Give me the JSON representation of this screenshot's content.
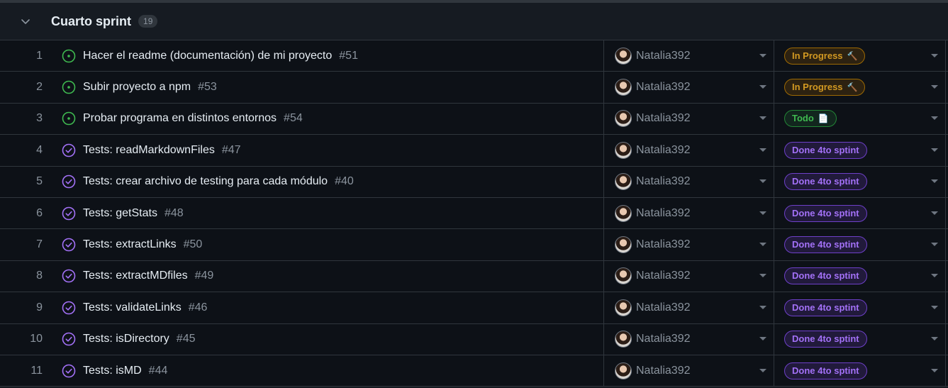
{
  "group": {
    "title": "Cuarto sprint",
    "count": "19"
  },
  "colors": {
    "open": "#3fb950",
    "done": "#a371f7",
    "progress": "#d29922"
  },
  "rows": [
    {
      "num": "1",
      "title": "Hacer el readme (documentación) de mi proyecto",
      "issue": "#51",
      "assignee": "Natalia392",
      "status": "In Progress",
      "status_emoji": "🔨",
      "state": "open",
      "kind": "progress"
    },
    {
      "num": "2",
      "title": "Subir proyecto a npm",
      "issue": "#53",
      "assignee": "Natalia392",
      "status": "In Progress",
      "status_emoji": "🔨",
      "state": "open",
      "kind": "progress"
    },
    {
      "num": "3",
      "title": "Probar programa en distintos entornos",
      "issue": "#54",
      "assignee": "Natalia392",
      "status": "Todo",
      "status_emoji": "📄",
      "state": "open",
      "kind": "todo"
    },
    {
      "num": "4",
      "title": "Tests: readMarkdownFiles",
      "issue": "#47",
      "assignee": "Natalia392",
      "status": "Done 4to sptint",
      "status_emoji": "",
      "state": "done",
      "kind": "done"
    },
    {
      "num": "5",
      "title": "Tests: crear archivo de testing para cada módulo",
      "issue": "#40",
      "assignee": "Natalia392",
      "status": "Done 4to sptint",
      "status_emoji": "",
      "state": "done",
      "kind": "done"
    },
    {
      "num": "6",
      "title": "Tests: getStats",
      "issue": "#48",
      "assignee": "Natalia392",
      "status": "Done 4to sptint",
      "status_emoji": "",
      "state": "done",
      "kind": "done"
    },
    {
      "num": "7",
      "title": "Tests: extractLinks",
      "issue": "#50",
      "assignee": "Natalia392",
      "status": "Done 4to sptint",
      "status_emoji": "",
      "state": "done",
      "kind": "done"
    },
    {
      "num": "8",
      "title": "Tests: extractMDfiles",
      "issue": "#49",
      "assignee": "Natalia392",
      "status": "Done 4to sptint",
      "status_emoji": "",
      "state": "done",
      "kind": "done"
    },
    {
      "num": "9",
      "title": "Tests: validateLinks",
      "issue": "#46",
      "assignee": "Natalia392",
      "status": "Done 4to sptint",
      "status_emoji": "",
      "state": "done",
      "kind": "done"
    },
    {
      "num": "10",
      "title": "Tests: isDirectory",
      "issue": "#45",
      "assignee": "Natalia392",
      "status": "Done 4to sptint",
      "status_emoji": "",
      "state": "done",
      "kind": "done"
    },
    {
      "num": "11",
      "title": "Tests: isMD",
      "issue": "#44",
      "assignee": "Natalia392",
      "status": "Done 4to sptint",
      "status_emoji": "",
      "state": "done",
      "kind": "done"
    }
  ]
}
